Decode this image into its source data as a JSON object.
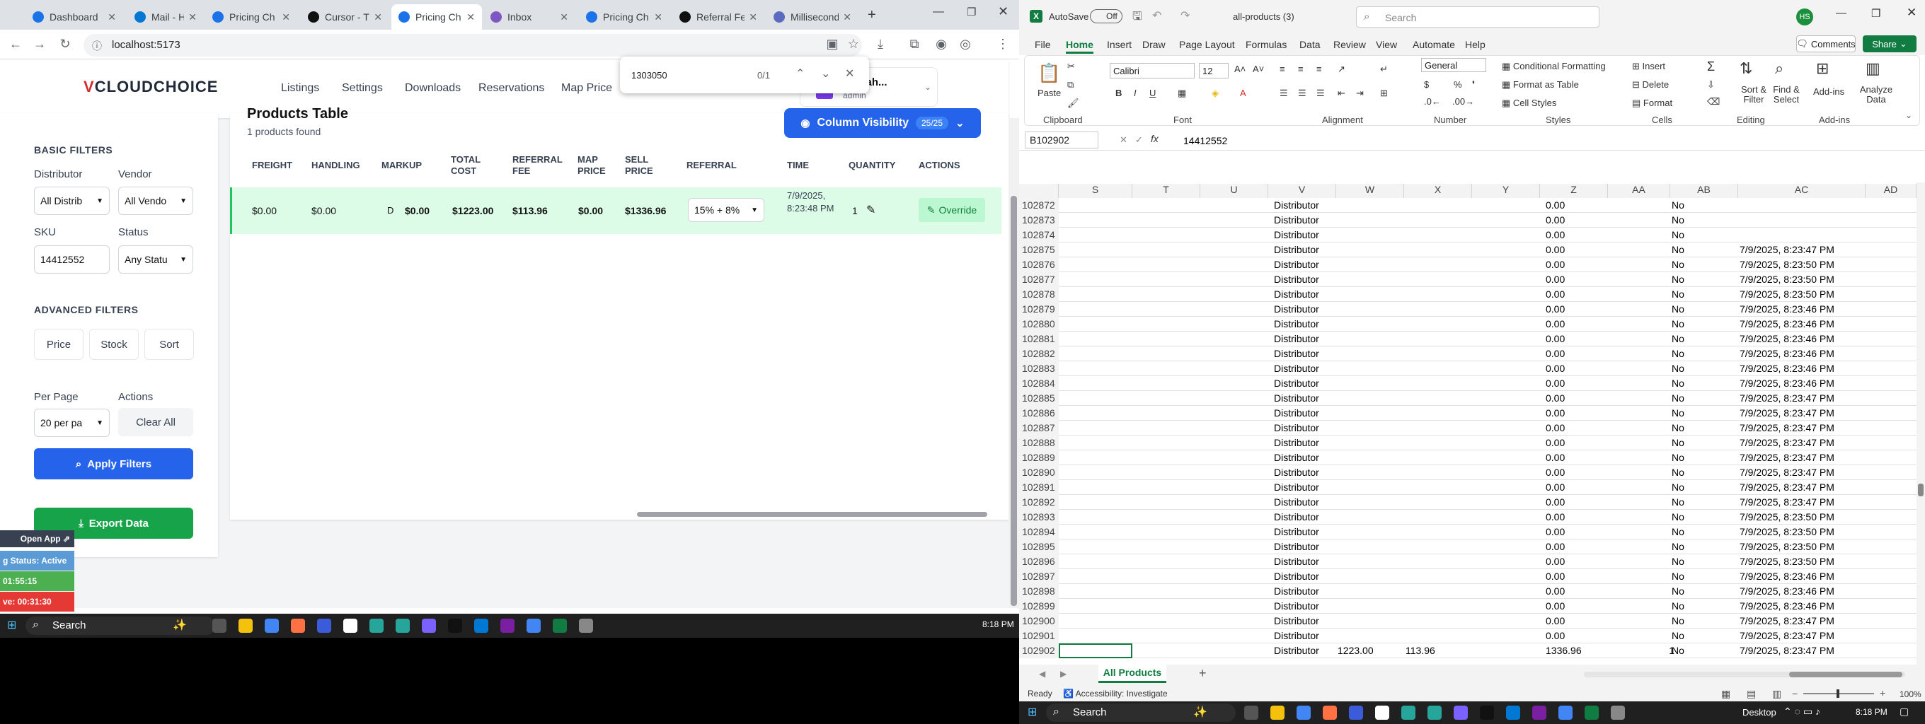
{
  "browser": {
    "tabs": [
      {
        "label": "Dashboard",
        "color": "#1a73e8",
        "active": false
      },
      {
        "label": "Mail - Has",
        "color": "#0078d4",
        "active": false
      },
      {
        "label": "Pricing Ch",
        "color": "#1a73e8",
        "active": false
      },
      {
        "label": "Cursor - Th",
        "color": "#111111",
        "active": false
      },
      {
        "label": "Pricing Ch",
        "color": "#1a73e8",
        "active": true
      },
      {
        "label": "Inbox",
        "color": "#7e57c2",
        "active": false
      },
      {
        "label": "Pricing Ch",
        "color": "#1a73e8",
        "active": false
      },
      {
        "label": "Referral Fe",
        "color": "#111111",
        "active": false
      },
      {
        "label": "Millisecond",
        "color": "#5c6bc0",
        "active": false
      }
    ],
    "url": "localhost:5173",
    "find": {
      "query": "1303050",
      "count": "0/1"
    }
  },
  "app": {
    "logo": "CLOUDCHOICE",
    "logo_mark": "V",
    "nav": [
      "Listings",
      "Settings",
      "Downloads",
      "Reservations",
      "Map Price"
    ],
    "user": {
      "name": "b Shah...",
      "role": "admin"
    },
    "table_title": "Products Table",
    "products_found": "1 products found",
    "column_visibility": "Column Visibility",
    "column_count": "25/25",
    "sidebar": {
      "basic_filters": "BASIC FILTERS",
      "distributor_label": "Distributor",
      "distributor_value": "All Distrib",
      "vendor_label": "Vendor",
      "vendor_value": "All Vendo",
      "sku_label": "SKU",
      "sku_value": "14412552",
      "status_label": "Status",
      "status_value": "Any Statu",
      "advanced_filters": "ADVANCED FILTERS",
      "price": "Price",
      "stock": "Stock",
      "sort": "Sort",
      "per_page_label": "Per Page",
      "per_page_value": "20 per pa",
      "actions_label": "Actions",
      "clear_all": "Clear All",
      "apply_filters": "Apply Filters",
      "export_data": "Export Data"
    },
    "table": {
      "headers": [
        "FREIGHT",
        "HANDLING",
        "MARKUP",
        "TOTAL COST",
        "REFERRAL FEE",
        "MAP PRICE",
        "SELL PRICE",
        "REFERRAL",
        "TIME",
        "QUANTITY",
        "ACTIONS"
      ],
      "row": {
        "freight": "$0.00",
        "handling": "$0.00",
        "markup_type": "D",
        "markup": "$0.00",
        "total_cost": "$1223.00",
        "referral_fee": "$113.96",
        "map_price": "$0.00",
        "sell_price": "$1336.96",
        "referral": "15% + 8%",
        "time": "7/9/2025, 8:23:48 PM",
        "quantity": "1",
        "action": "Override"
      }
    }
  },
  "widget": {
    "open_app": "Open App",
    "status": "g Status: Active",
    "t1": "01:55:15",
    "t2": "ve: 00:31:30"
  },
  "taskbar_left": {
    "search": "Search",
    "time": "8:18 PM"
  },
  "excel": {
    "autosave": "AutoSave",
    "autosave_state": "Off",
    "filename": "all-products (3)",
    "search": "Search",
    "avatar": "HS",
    "ribbon_tabs": [
      "File",
      "Home",
      "Insert",
      "Draw",
      "Page Layout",
      "Formulas",
      "Data",
      "Review",
      "View",
      "Automate",
      "Help"
    ],
    "comments": "Comments",
    "share": "Share",
    "font": "Calibri",
    "font_size": "12",
    "number_format": "General",
    "groups": [
      "Clipboard",
      "Font",
      "Alignment",
      "Number",
      "Styles",
      "Cells",
      "Editing",
      "Add-ins"
    ],
    "styles_buttons": [
      "Conditional Formatting",
      "Format as Table",
      "Cell Styles"
    ],
    "cells_buttons": [
      "Insert",
      "Delete",
      "Format"
    ],
    "editing_buttons": [
      "Sort & Filter",
      "Find & Select"
    ],
    "addins_buttons": [
      "Add-ins",
      "Analyze Data"
    ],
    "paste": "Paste",
    "name_box": "B102902",
    "formula": "14412552",
    "columns": [
      "S",
      "T",
      "U",
      "V",
      "W",
      "X",
      "Y",
      "Z",
      "AA",
      "AB",
      "AC",
      "AD"
    ],
    "rows": [
      {
        "n": "102872",
        "v": "Distributor",
        "z": "0.00",
        "ab": "No",
        "ac": ""
      },
      {
        "n": "102873",
        "v": "Distributor",
        "z": "0.00",
        "ab": "No",
        "ac": ""
      },
      {
        "n": "102874",
        "v": "Distributor",
        "z": "0.00",
        "ab": "No",
        "ac": ""
      },
      {
        "n": "102875",
        "v": "Distributor",
        "z": "0.00",
        "ab": "No",
        "ac": "7/9/2025, 8:23:47 PM"
      },
      {
        "n": "102876",
        "v": "Distributor",
        "z": "0.00",
        "ab": "No",
        "ac": "7/9/2025, 8:23:50 PM"
      },
      {
        "n": "102877",
        "v": "Distributor",
        "z": "0.00",
        "ab": "No",
        "ac": "7/9/2025, 8:23:50 PM"
      },
      {
        "n": "102878",
        "v": "Distributor",
        "z": "0.00",
        "ab": "No",
        "ac": "7/9/2025, 8:23:50 PM"
      },
      {
        "n": "102879",
        "v": "Distributor",
        "z": "0.00",
        "ab": "No",
        "ac": "7/9/2025, 8:23:46 PM"
      },
      {
        "n": "102880",
        "v": "Distributor",
        "z": "0.00",
        "ab": "No",
        "ac": "7/9/2025, 8:23:46 PM"
      },
      {
        "n": "102881",
        "v": "Distributor",
        "z": "0.00",
        "ab": "No",
        "ac": "7/9/2025, 8:23:46 PM"
      },
      {
        "n": "102882",
        "v": "Distributor",
        "z": "0.00",
        "ab": "No",
        "ac": "7/9/2025, 8:23:46 PM"
      },
      {
        "n": "102883",
        "v": "Distributor",
        "z": "0.00",
        "ab": "No",
        "ac": "7/9/2025, 8:23:46 PM"
      },
      {
        "n": "102884",
        "v": "Distributor",
        "z": "0.00",
        "ab": "No",
        "ac": "7/9/2025, 8:23:46 PM"
      },
      {
        "n": "102885",
        "v": "Distributor",
        "z": "0.00",
        "ab": "No",
        "ac": "7/9/2025, 8:23:47 PM"
      },
      {
        "n": "102886",
        "v": "Distributor",
        "z": "0.00",
        "ab": "No",
        "ac": "7/9/2025, 8:23:47 PM"
      },
      {
        "n": "102887",
        "v": "Distributor",
        "z": "0.00",
        "ab": "No",
        "ac": "7/9/2025, 8:23:47 PM"
      },
      {
        "n": "102888",
        "v": "Distributor",
        "z": "0.00",
        "ab": "No",
        "ac": "7/9/2025, 8:23:47 PM"
      },
      {
        "n": "102889",
        "v": "Distributor",
        "z": "0.00",
        "ab": "No",
        "ac": "7/9/2025, 8:23:47 PM"
      },
      {
        "n": "102890",
        "v": "Distributor",
        "z": "0.00",
        "ab": "No",
        "ac": "7/9/2025, 8:23:47 PM"
      },
      {
        "n": "102891",
        "v": "Distributor",
        "z": "0.00",
        "ab": "No",
        "ac": "7/9/2025, 8:23:47 PM"
      },
      {
        "n": "102892",
        "v": "Distributor",
        "z": "0.00",
        "ab": "No",
        "ac": "7/9/2025, 8:23:47 PM"
      },
      {
        "n": "102893",
        "v": "Distributor",
        "z": "0.00",
        "ab": "No",
        "ac": "7/9/2025, 8:23:50 PM"
      },
      {
        "n": "102894",
        "v": "Distributor",
        "z": "0.00",
        "ab": "No",
        "ac": "7/9/2025, 8:23:50 PM"
      },
      {
        "n": "102895",
        "v": "Distributor",
        "z": "0.00",
        "ab": "No",
        "ac": "7/9/2025, 8:23:50 PM"
      },
      {
        "n": "102896",
        "v": "Distributor",
        "z": "0.00",
        "ab": "No",
        "ac": "7/9/2025, 8:23:50 PM"
      },
      {
        "n": "102897",
        "v": "Distributor",
        "z": "0.00",
        "ab": "No",
        "ac": "7/9/2025, 8:23:46 PM"
      },
      {
        "n": "102898",
        "v": "Distributor",
        "z": "0.00",
        "ab": "No",
        "ac": "7/9/2025, 8:23:46 PM"
      },
      {
        "n": "102899",
        "v": "Distributor",
        "z": "0.00",
        "ab": "No",
        "ac": "7/9/2025, 8:23:46 PM"
      },
      {
        "n": "102900",
        "v": "Distributor",
        "z": "0.00",
        "ab": "No",
        "ac": "7/9/2025, 8:23:47 PM"
      },
      {
        "n": "102901",
        "v": "Distributor",
        "z": "0.00",
        "ab": "No",
        "ac": "7/9/2025, 8:23:47 PM"
      },
      {
        "n": "102902",
        "v": "Distributor",
        "w": "1223.00",
        "x": "113.96",
        "z": "1336.96",
        "aa": "1",
        "ab": "No",
        "ac": "7/9/2025, 8:23:47 PM"
      }
    ],
    "sheet_tab": "All Products",
    "status_ready": "Ready",
    "accessibility": "Accessibility: Investigate",
    "display": "Desktop",
    "zoom": "100%"
  },
  "taskbar_right": {
    "search": "Search",
    "time": "8:18 PM"
  }
}
